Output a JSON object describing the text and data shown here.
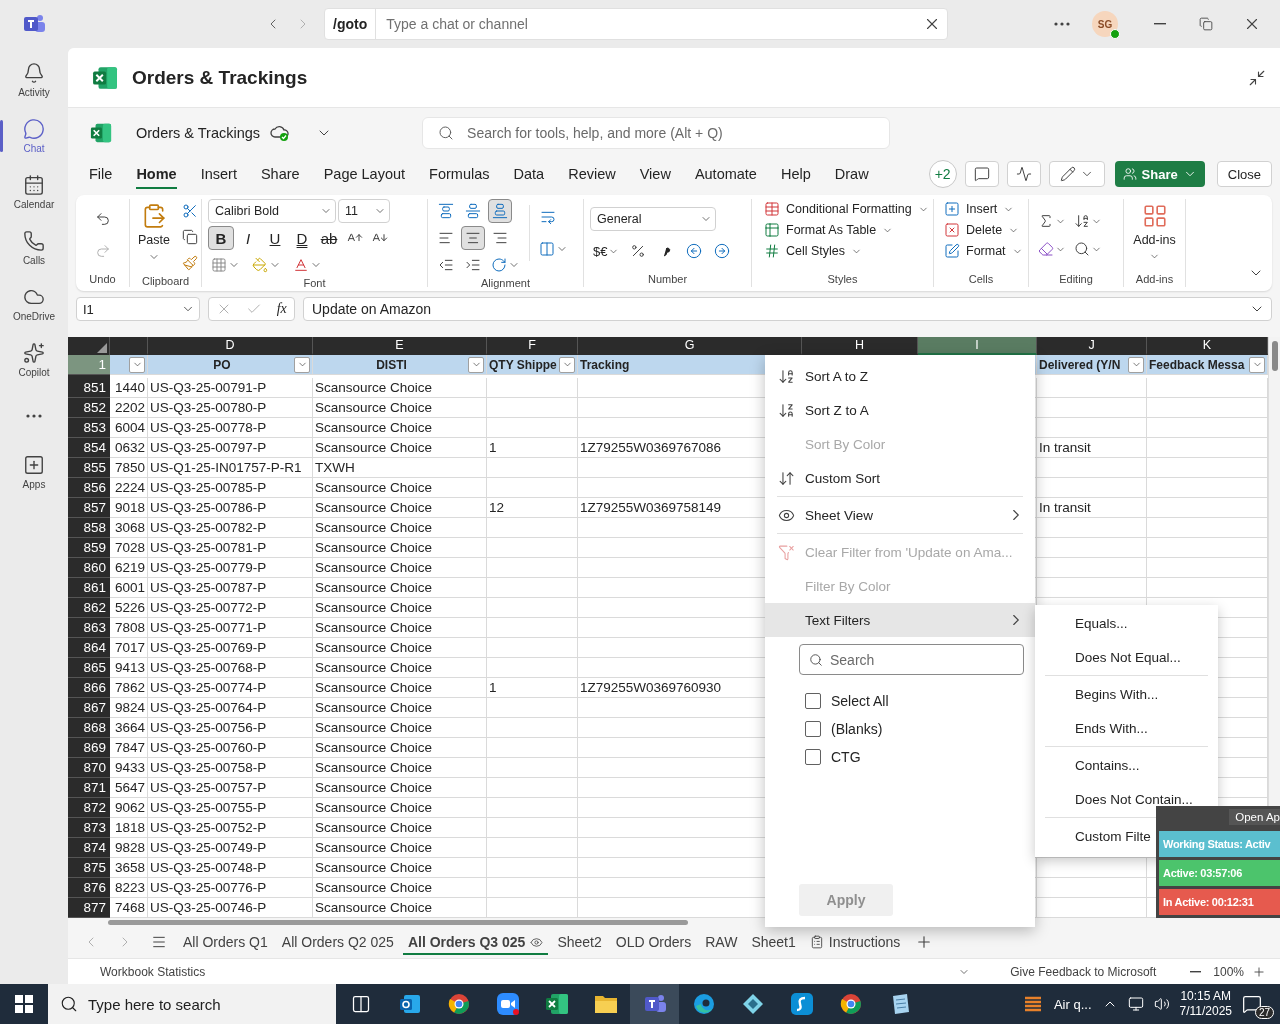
{
  "teams": {
    "goto_label": "/goto",
    "search_placeholder": "Type a chat or channel",
    "avatar_initials": "SG"
  },
  "rail": [
    {
      "label": "Activity",
      "kind": "bell",
      "selected": false
    },
    {
      "label": "Chat",
      "kind": "chat",
      "selected": true
    },
    {
      "label": "Calendar",
      "kind": "calendar",
      "selected": false
    },
    {
      "label": "Calls",
      "kind": "phone",
      "selected": false
    },
    {
      "label": "OneDrive",
      "kind": "cloud",
      "selected": false
    },
    {
      "label": "Copilot",
      "kind": "copilot",
      "selected": false
    },
    {
      "kind": "more",
      "selected": false
    },
    {
      "label": "Apps",
      "kind": "apps",
      "selected": false
    }
  ],
  "app_header": {
    "title": "Orders & Trackings"
  },
  "excel": {
    "file_name": "Orders & Trackings",
    "search_placeholder": "Search for tools, help, and more (Alt + Q)",
    "menu_tabs": [
      {
        "label": "File",
        "selected": false
      },
      {
        "label": "Home",
        "selected": true
      },
      {
        "label": "Insert",
        "selected": false
      },
      {
        "label": "Share",
        "selected": false
      },
      {
        "label": "Page Layout",
        "selected": false
      },
      {
        "label": "Formulas",
        "selected": false
      },
      {
        "label": "Data",
        "selected": false
      },
      {
        "label": "Review",
        "selected": false
      },
      {
        "label": "View",
        "selected": false
      },
      {
        "label": "Automate",
        "selected": false
      },
      {
        "label": "Help",
        "selected": false
      },
      {
        "label": "Draw",
        "selected": false
      }
    ],
    "collaborators_badge": "+2",
    "share_label": "Share",
    "close_label": "Close"
  },
  "ribbon": {
    "undo": {
      "group_label": "Undo"
    },
    "clipboard": {
      "paste_label": "Paste",
      "group_label": "Clipboard"
    },
    "font": {
      "name": "Calibri Bold",
      "size": "11",
      "group_label": "Font",
      "style_buttons": [
        {
          "label": "B",
          "kind": "bold",
          "selected": true
        },
        {
          "label": "I",
          "kind": "italic",
          "selected": false
        },
        {
          "label": "U",
          "kind": "underline",
          "selected": false
        },
        {
          "label": "D",
          "kind": "double_underline",
          "selected": false
        },
        {
          "label": "ab",
          "kind": "strike",
          "selected": false
        }
      ]
    },
    "alignment": {
      "group_label": "Alignment",
      "vertical": [
        {
          "kind": "top",
          "selected": false
        },
        {
          "kind": "middle",
          "selected": false
        },
        {
          "kind": "bottom",
          "selected": true
        }
      ],
      "horizontal": [
        {
          "kind": "left",
          "selected": false
        },
        {
          "kind": "center",
          "selected": true
        },
        {
          "kind": "right",
          "selected": false
        }
      ]
    },
    "number": {
      "format": "General",
      "currency_label": "$€",
      "group_label": "Number"
    },
    "styles": {
      "commands": [
        "Conditional Formatting",
        "Format As Table",
        "Cell Styles"
      ],
      "group_label": "Styles"
    },
    "cells": {
      "commands": [
        "Insert",
        "Delete",
        "Format"
      ],
      "group_label": "Cells"
    },
    "editing": {
      "group_label": "Editing"
    },
    "addins": {
      "button_label": "Add-ins",
      "group_label": "Add-ins"
    }
  },
  "formula_bar": {
    "name_box": "I1",
    "function_label": "fx",
    "value": "Update on Amazon"
  },
  "sheet": {
    "column_letters": [
      {
        "letter": "D",
        "selected": false
      },
      {
        "letter": "E",
        "selected": false
      },
      {
        "letter": "F",
        "selected": false
      },
      {
        "letter": "G",
        "selected": false
      },
      {
        "letter": "H",
        "selected": false
      },
      {
        "letter": "I",
        "selected": true
      },
      {
        "letter": "J",
        "selected": false
      },
      {
        "letter": "K",
        "selected": false
      }
    ],
    "header_row": {
      "number": "1",
      "cells": [
        {
          "filter": true
        },
        {
          "text": "PO",
          "filter": true
        },
        {
          "text": "DISTI",
          "filter": true
        },
        {
          "text": "QTY Shippe",
          "filter": true
        },
        {
          "text": "Tracking"
        },
        {},
        {},
        {
          "text": "Delivered (Y/N",
          "filter": true
        },
        {
          "text": "Feedback Messa",
          "filter": true
        }
      ]
    },
    "rows": [
      {
        "number": "851",
        "column_c": "1440",
        "po": "US-Q3-25-00791-P",
        "disti": "Scansource Choice"
      },
      {
        "number": "852",
        "column_c": "2202",
        "po": "US-Q3-25-00780-P",
        "disti": "Scansource Choice"
      },
      {
        "number": "853",
        "column_c": "6004",
        "po": "US-Q3-25-00778-P",
        "disti": "Scansource Choice"
      },
      {
        "number": "854",
        "column_c": "0632",
        "po": "US-Q3-25-00797-P",
        "disti": "Scansource Choice",
        "qty_shipped": "1",
        "tracking": "1Z79255W0369767086",
        "delivered": "In transit"
      },
      {
        "number": "855",
        "column_c": "7850",
        "po": "US-Q1-25-IN01757-P-R1",
        "disti": "TXWH"
      },
      {
        "number": "856",
        "column_c": "2224",
        "po": "US-Q3-25-00785-P",
        "disti": "Scansource Choice"
      },
      {
        "number": "857",
        "column_c": "9018",
        "po": "US-Q3-25-00786-P",
        "disti": "Scansource Choice",
        "qty_shipped": "12",
        "tracking": "1Z79255W0369758149",
        "delivered": "In transit"
      },
      {
        "number": "858",
        "column_c": "3068",
        "po": "US-Q3-25-00782-P",
        "disti": "Scansource Choice"
      },
      {
        "number": "859",
        "column_c": "7028",
        "po": "US-Q3-25-00781-P",
        "disti": "Scansource Choice"
      },
      {
        "number": "860",
        "column_c": "6219",
        "po": "US-Q3-25-00779-P",
        "disti": "Scansource Choice"
      },
      {
        "number": "861",
        "column_c": "6001",
        "po": "US-Q3-25-00787-P",
        "disti": "Scansource Choice"
      },
      {
        "number": "862",
        "column_c": "5226",
        "po": "US-Q3-25-00772-P",
        "disti": "Scansource Choice"
      },
      {
        "number": "863",
        "column_c": "7808",
        "po": "US-Q3-25-00771-P",
        "disti": "Scansource Choice"
      },
      {
        "number": "864",
        "column_c": "7017",
        "po": "US-Q3-25-00769-P",
        "disti": "Scansource Choice"
      },
      {
        "number": "865",
        "column_c": "9413",
        "po": "US-Q3-25-00768-P",
        "disti": "Scansource Choice"
      },
      {
        "number": "866",
        "column_c": "7862",
        "po": "US-Q3-25-00774-P",
        "disti": "Scansource Choice",
        "qty_shipped": "1",
        "tracking": "1Z79255W0369760930"
      },
      {
        "number": "867",
        "column_c": "9824",
        "po": "US-Q3-25-00764-P",
        "disti": "Scansource Choice"
      },
      {
        "number": "868",
        "column_c": "3664",
        "po": "US-Q3-25-00756-P",
        "disti": "Scansource Choice"
      },
      {
        "number": "869",
        "column_c": "7847",
        "po": "US-Q3-25-00760-P",
        "disti": "Scansource Choice"
      },
      {
        "number": "870",
        "column_c": "9433",
        "po": "US-Q3-25-00758-P",
        "disti": "Scansource Choice"
      },
      {
        "number": "871",
        "column_c": "5647",
        "po": "US-Q3-25-00757-P",
        "disti": "Scansource Choice"
      },
      {
        "number": "872",
        "column_c": "9062",
        "po": "US-Q3-25-00755-P",
        "disti": "Scansource Choice"
      },
      {
        "number": "873",
        "column_c": "1818",
        "po": "US-Q3-25-00752-P",
        "disti": "Scansource Choice"
      },
      {
        "number": "874",
        "column_c": "9828",
        "po": "US-Q3-25-00749-P",
        "disti": "Scansource Choice"
      },
      {
        "number": "875",
        "column_c": "3658",
        "po": "US-Q3-25-00748-P",
        "disti": "Scansource Choice"
      },
      {
        "number": "876",
        "column_c": "8223",
        "po": "US-Q3-25-00776-P",
        "disti": "Scansource Choice"
      },
      {
        "number": "877",
        "column_c": "7468",
        "po": "US-Q3-25-00746-P",
        "disti": "Scansource Choice"
      }
    ]
  },
  "filter_menu": {
    "items": [
      {
        "label": "Sort A to Z",
        "kind": "sort_asc",
        "disabled": false,
        "submenu": false,
        "highlighted": false,
        "divider_before": false
      },
      {
        "label": "Sort Z to A",
        "kind": "sort_desc",
        "disabled": false,
        "submenu": false,
        "highlighted": false,
        "divider_before": false
      },
      {
        "label": "Sort By Color",
        "kind": "plain",
        "disabled": true,
        "submenu": false,
        "highlighted": false,
        "divider_before": false
      },
      {
        "label": "Custom Sort",
        "kind": "custom_sort",
        "disabled": false,
        "submenu": false,
        "highlighted": false,
        "divider_before": false
      },
      {
        "label": "Sheet View",
        "kind": "sheet_view",
        "disabled": false,
        "submenu": true,
        "highlighted": false,
        "divider_before": true
      },
      {
        "label": "Clear Filter from 'Update on Ama...",
        "kind": "clear_filter",
        "disabled": true,
        "submenu": false,
        "highlighted": false,
        "divider_before": true
      },
      {
        "label": "Filter By Color",
        "kind": "plain",
        "disabled": true,
        "submenu": false,
        "highlighted": false,
        "divider_before": false
      },
      {
        "label": "Text Filters",
        "kind": "plain",
        "disabled": false,
        "submenu": true,
        "highlighted": true,
        "divider_before": false
      }
    ],
    "search_placeholder": "Search",
    "values": [
      {
        "label": "Select All",
        "checked": false
      },
      {
        "label": "(Blanks)",
        "checked": false
      },
      {
        "label": "CTG",
        "checked": false
      }
    ],
    "apply_label": "Apply",
    "apply_disabled": true
  },
  "text_filters_submenu": {
    "items": [
      {
        "label": "Equals...",
        "divider_before": false
      },
      {
        "label": "Does Not Equal...",
        "divider_before": false
      },
      {
        "label": "Begins With...",
        "divider_before": true
      },
      {
        "label": "Ends With...",
        "divider_before": false
      },
      {
        "label": "Contains...",
        "divider_before": true
      },
      {
        "label": "Does Not Contain...",
        "divider_before": false
      },
      {
        "label": "Custom Filte",
        "divider_before": true
      }
    ]
  },
  "status_widget": {
    "title": "Open Ap",
    "rows": [
      {
        "label": "Working Status: Activ",
        "color": "#5bbfcf"
      },
      {
        "label": "Active: 03:57:06",
        "color": "#4cc46c"
      },
      {
        "label": "In Active: 00:12:31",
        "color": "#e65a4e"
      }
    ]
  },
  "sheet_tabs": [
    {
      "label": "All Orders Q1",
      "kind": "plain",
      "selected": false
    },
    {
      "label": "All Orders Q2 025",
      "kind": "plain",
      "selected": false
    },
    {
      "label": "All Orders Q3 025",
      "kind": "view",
      "selected": true
    },
    {
      "label": "Sheet2",
      "kind": "plain",
      "selected": false
    },
    {
      "label": "OLD Orders",
      "kind": "plain",
      "selected": false
    },
    {
      "label": "RAW",
      "kind": "plain",
      "selected": false
    },
    {
      "label": "Sheet1",
      "kind": "plain",
      "selected": false
    },
    {
      "label": "Instructions",
      "kind": "note",
      "selected": false
    }
  ],
  "status_bar": {
    "statistics": "Workbook Statistics",
    "feedback": "Give Feedback to Microsoft",
    "zoom": "100%"
  },
  "taskbar": {
    "search_placeholder": "Type here to search",
    "weather": "Air q...",
    "time": "10:15 AM",
    "date": "7/11/2025",
    "notifications": "27",
    "apps": [
      {
        "kind": "task_view",
        "selected": false
      },
      {
        "kind": "mail",
        "selected": false
      },
      {
        "kind": "browser",
        "selected": false
      },
      {
        "kind": "video",
        "selected": false
      },
      {
        "kind": "sheet",
        "selected": false
      },
      {
        "kind": "folder",
        "selected": false
      },
      {
        "kind": "chat",
        "selected": true
      },
      {
        "kind": "edge",
        "selected": false
      },
      {
        "kind": "diamond",
        "selected": false
      },
      {
        "kind": "swirl",
        "selected": false
      },
      {
        "kind": "browser",
        "selected": false
      },
      {
        "kind": "notepad",
        "selected": false
      }
    ]
  }
}
